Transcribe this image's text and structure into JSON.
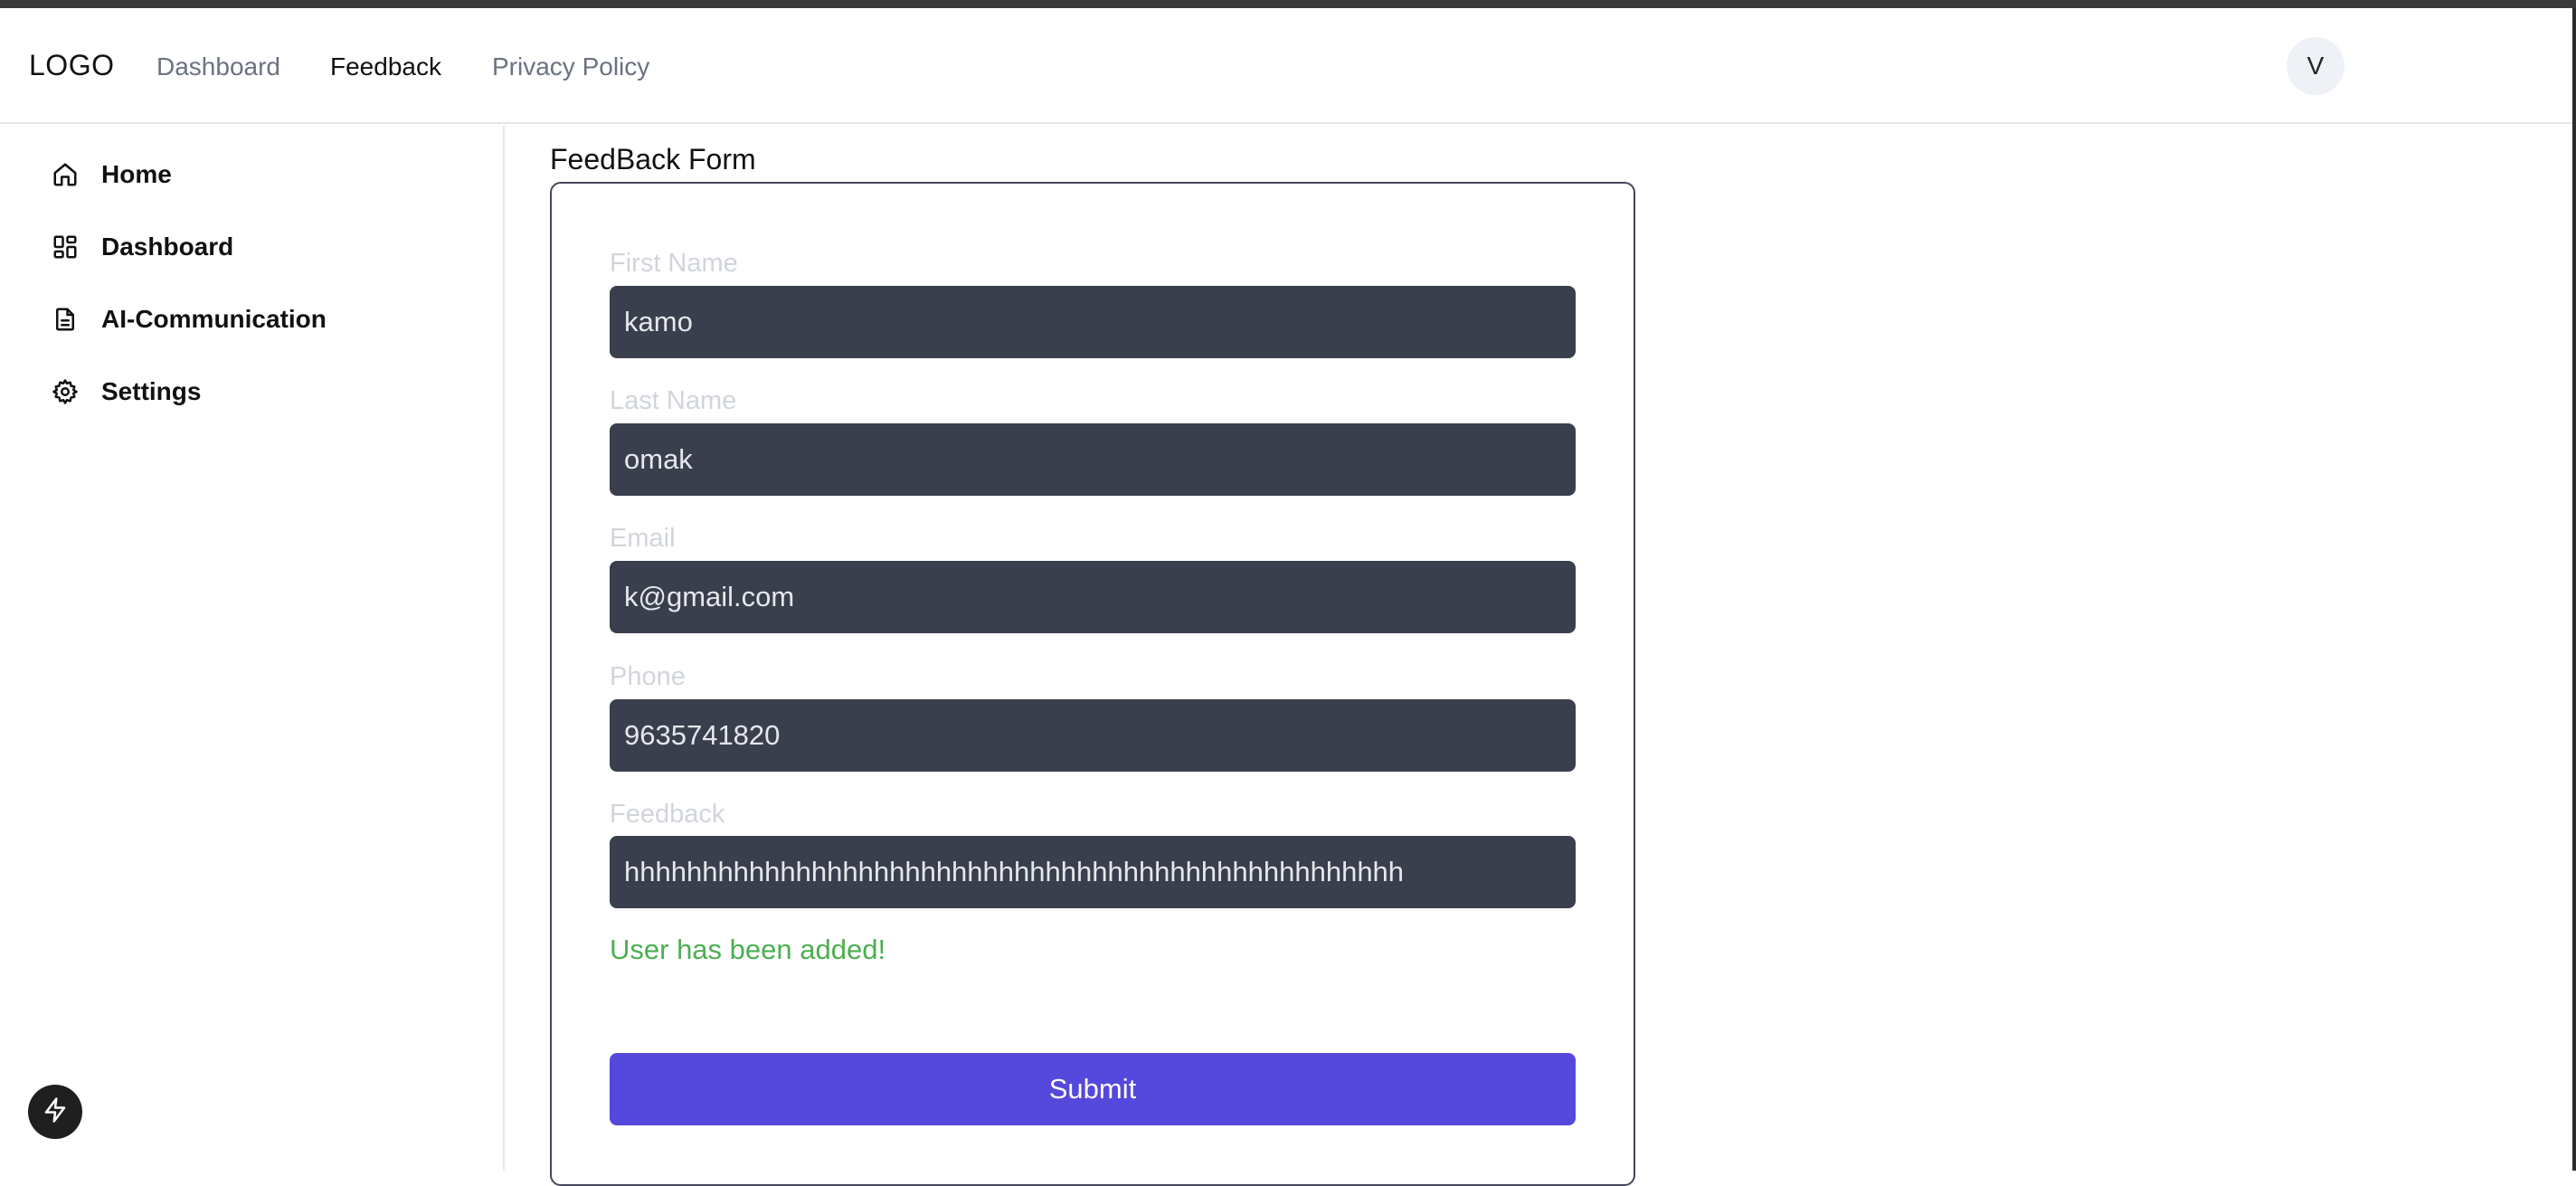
{
  "navbar": {
    "logo": "LOGO",
    "links": [
      {
        "label": "Dashboard"
      },
      {
        "label": "Feedback"
      },
      {
        "label": "Privacy Policy"
      }
    ],
    "active_link": "Feedback",
    "avatar_initial": "V"
  },
  "sidebar": {
    "items": [
      {
        "label": "Home",
        "icon": "home-icon"
      },
      {
        "label": "Dashboard",
        "icon": "dashboard-icon"
      },
      {
        "label": "AI-Communication",
        "icon": "document-icon"
      },
      {
        "label": "Settings",
        "icon": "gear-icon"
      }
    ]
  },
  "form": {
    "title": "FeedBack Form",
    "fields": [
      {
        "label": "First Name",
        "value": "kamo"
      },
      {
        "label": "Last Name",
        "value": "omak"
      },
      {
        "label": "Email",
        "value": "k@gmail.com"
      },
      {
        "label": "Phone",
        "value": "9635741820"
      },
      {
        "label": "Feedback",
        "value": "hhhhhhhhhhhhhhhhhhhhhhhhhhhhhhhhhhhhhhhhhhhhhhhhhh"
      }
    ],
    "success_message": "User has been added!",
    "submit_label": "Submit"
  },
  "colors": {
    "accent": "#5548dc",
    "input_bg": "#3a3f4e",
    "success": "#4caf50"
  },
  "floating_button_icon": "bolt-icon"
}
